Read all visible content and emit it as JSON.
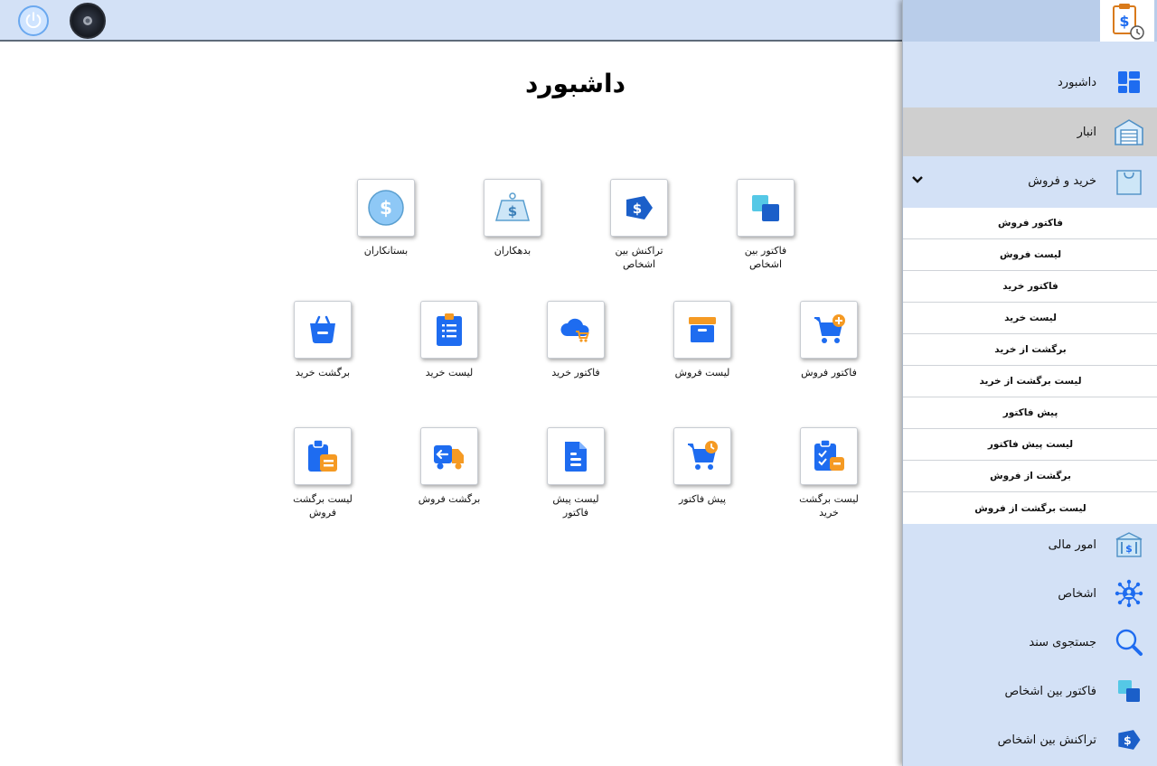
{
  "page": {
    "title": "داشبورد"
  },
  "topbar": {
    "power_icon": "power-icon",
    "avatar_icon": "avatar"
  },
  "tiles": [
    {
      "label": "فاکتور بین اشخاص",
      "icon": "squares-icon"
    },
    {
      "label": "تراکنش بین اشخاص",
      "icon": "dollar-tag-icon"
    },
    {
      "label": "بدهکاران",
      "icon": "weight-dollar-icon"
    },
    {
      "label": "بستانکاران",
      "icon": "dollar-coin-icon"
    },
    {
      "label": "فاکتور فروش",
      "icon": "cart-plus-icon"
    },
    {
      "label": "لیست فروش",
      "icon": "archive-box-icon"
    },
    {
      "label": "فاکتور خرید",
      "icon": "cloud-cart-icon"
    },
    {
      "label": "لیست خرید",
      "icon": "clipboard-list-icon"
    },
    {
      "label": "برگشت خرید",
      "icon": "basket-minus-icon"
    },
    {
      "label": "لیست برگشت خرید",
      "icon": "clipboard-check-icon"
    },
    {
      "label": "پیش فاکتور",
      "icon": "cart-clock-icon"
    },
    {
      "label": "لیست پیش فاکتور",
      "icon": "document-icon"
    },
    {
      "label": "برگشت فروش",
      "icon": "truck-return-icon"
    },
    {
      "label": "لیست برگشت فروش",
      "icon": "clipboard-box-icon"
    }
  ],
  "sidebar": {
    "items": [
      {
        "label": "داشبورد",
        "icon": "dashboard-icon"
      },
      {
        "label": "انبار",
        "icon": "warehouse-icon"
      },
      {
        "label": "خرید و فروش",
        "icon": "shopping-bag-icon"
      },
      {
        "label": "امور مالی",
        "icon": "bank-icon"
      },
      {
        "label": "اشخاص",
        "icon": "network-people-icon"
      },
      {
        "label": "جستجوی سند",
        "icon": "magnifier-icon"
      },
      {
        "label": "فاکتور بین اشخاص",
        "icon": "squares-icon"
      },
      {
        "label": "تراکنش بین اشخاص",
        "icon": "dollar-tag-icon"
      }
    ],
    "submenu": [
      "فاکتور فروش",
      "لیست فروش",
      "فاکتور خرید",
      "لیست خرید",
      "برگشت از خرید",
      "لیست برگشت از خرید",
      "پیش فاکتور",
      "لیست پیش فاکتور",
      "برگشت از فروش",
      "لیست برگشت از فروش"
    ]
  },
  "colors": {
    "topbar_bg": "#d3e1f6",
    "accent_blue": "#1e6cf0",
    "accent_orange": "#f59a23",
    "active_item_bg": "#cfcfcf"
  }
}
